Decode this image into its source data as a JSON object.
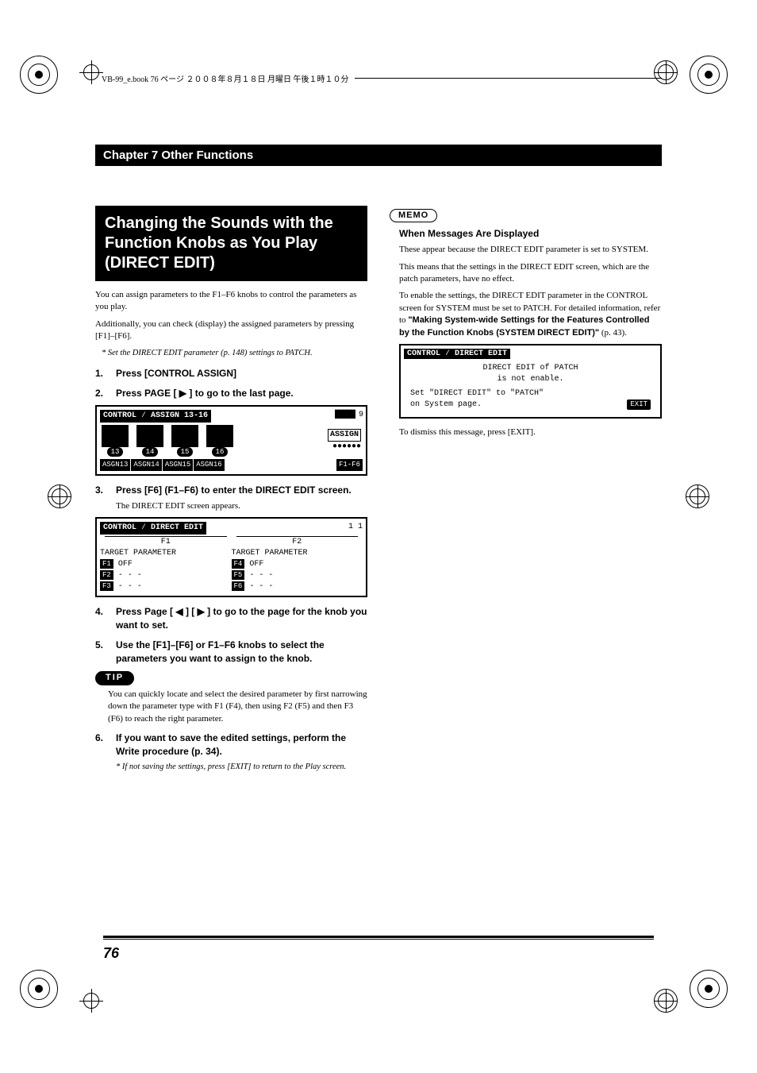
{
  "header": {
    "file_info": "VB-99_e.book 76 ページ ２００８年８月１８日 月曜日 午後１時１０分"
  },
  "chapter_title": "Chapter 7 Other Functions",
  "title_block": "Changing the Sounds with the Function Knobs as You Play (DIRECT EDIT)",
  "intro": {
    "p1": "You can assign parameters to the F1–F6 knobs to control the parameters as you play.",
    "p2": "Additionally, you can check (display) the assigned parameters by pressing [F1]–[F6].",
    "note": "* Set the DIRECT EDIT parameter (p. 148) settings to PATCH."
  },
  "steps": {
    "s1": "Press [CONTROL ASSIGN]",
    "s2": "Press PAGE [ ▶ ] to go to the last page.",
    "s3": "Press [F6] (F1–F6) to enter the DIRECT EDIT screen.",
    "s3_sub": "The DIRECT EDIT screen appears.",
    "s4": "Press Page [ ◀ ] [ ▶ ] to go to the page for the knob you want to set.",
    "s5": "Use the [F1]–[F6] or F1–F6 knobs to select the parameters you want to assign to the knob.",
    "s6": "If you want to save the edited settings, perform the Write procedure (p. 34).",
    "s6_note": "* If not saving the settings, press [EXIT] to return to the Play screen."
  },
  "tip": {
    "label": "TIP",
    "text": "You can quickly locate and select the desired parameter by first narrowing down the parameter type with F1 (F4), then using F2 (F5) and then F3 (F6) to reach the right parameter."
  },
  "memo": {
    "label": "MEMO",
    "heading": "When Messages Are Displayed",
    "p1": "These appear because the DIRECT EDIT parameter is set to SYSTEM.",
    "p2": "This means that the settings in the DIRECT EDIT screen, which are the patch parameters, have no effect.",
    "p3_pre": "To enable the settings, the DIRECT EDIT parameter in the CONTROL screen for SYSTEM must be set to PATCH. For detailed information, refer to ",
    "p3_bold": "\"Making System-wide Settings for the Features Controlled by the Function Knobs (SYSTEM DIRECT EDIT)\"",
    "p3_post": " (p. 43).",
    "dismissal": "To dismiss this message, press [EXIT]."
  },
  "figure1": {
    "title": "CONTROL ⁄ ASSIGN 13-16",
    "right_indicator": "█████ 9",
    "badges": [
      "13",
      "14",
      "15",
      "16"
    ],
    "side_label": "ASSIGN",
    "tabs": [
      "ASGN13",
      "ASGN14",
      "ASGN15",
      "ASGN16"
    ],
    "tab_right": "F1-F6"
  },
  "figure2": {
    "title": "CONTROL ⁄ DIRECT EDIT",
    "right_indicator": "1 1",
    "col1_hdr": "F1",
    "col2_hdr": "F2",
    "param_hdr": "TARGET PARAMETER",
    "rows_l": [
      "F1",
      "F2",
      "F3"
    ],
    "rows_r": [
      "F4",
      "F5",
      "F6"
    ],
    "val_off": "OFF",
    "val_dash": "- - -"
  },
  "figure3": {
    "title": "CONTROL ⁄ DIRECT EDIT",
    "line1": "DIRECT EDIT of PATCH",
    "line2": "is not enable.",
    "line3": "Set \"DIRECT EDIT\" to \"PATCH\"",
    "line4": "on System page.",
    "exit": "EXIT"
  },
  "page_number": "76"
}
